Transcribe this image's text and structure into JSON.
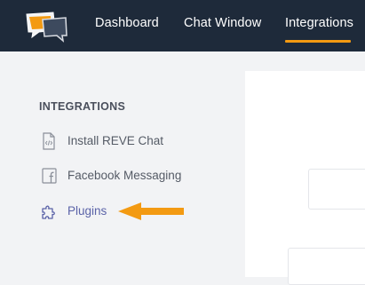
{
  "header": {
    "logo_icon": "chat-bubbles-logo",
    "nav": [
      {
        "label": "Dashboard",
        "active": false
      },
      {
        "label": "Chat Window",
        "active": false
      },
      {
        "label": "Integrations",
        "active": true
      }
    ]
  },
  "sidebar": {
    "heading": "INTEGRATIONS",
    "items": [
      {
        "label": "Install REVE Chat",
        "icon": "code-file-icon",
        "active": false
      },
      {
        "label": "Facebook Messaging",
        "icon": "facebook-icon",
        "active": false
      },
      {
        "label": "Plugins",
        "icon": "puzzle-icon",
        "active": true
      }
    ]
  },
  "annotation": {
    "icon": "arrow-left-icon",
    "color": "#f39a12"
  },
  "colors": {
    "topbar": "#1e2a3a",
    "accent": "#f39a12",
    "active_item": "#5b63a8"
  }
}
